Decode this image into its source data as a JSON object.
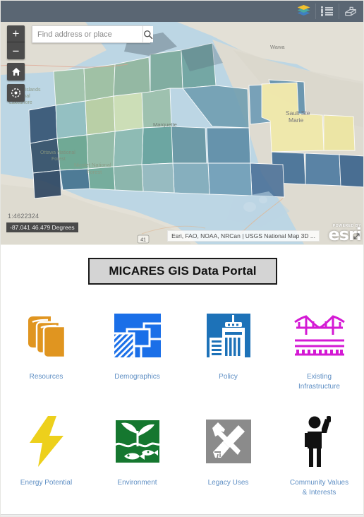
{
  "header": {
    "buttons": [
      {
        "name": "layers-icon",
        "label": "Layers"
      },
      {
        "name": "legend-icon",
        "label": "Legend"
      },
      {
        "name": "basemap-gallery-icon",
        "label": "Basemap Gallery"
      }
    ],
    "background_color": "#5a6673"
  },
  "map": {
    "search": {
      "placeholder": "Find address or place",
      "value": "",
      "button_icon": "search-icon"
    },
    "controls": {
      "zoom_in": "+",
      "zoom_out": "−",
      "home_icon": "home-icon",
      "locate_icon": "locate-icon"
    },
    "scale": "1:4622324",
    "coordinates": "-87.041 46.479 Degrees",
    "attribution": "Esri, FAO, NOAA, NRCan | USGS National Map 3D ...",
    "logo": {
      "powered_by": "POWERED BY",
      "brand": "esri"
    },
    "place_labels": [
      "Wawa",
      "Sault Ste Marie",
      "Marquette",
      "Apostle Islands National Lakeshore",
      "Ottawa National Forest",
      "Nicolet National Forest"
    ],
    "highway_shield": "41",
    "colors": {
      "water": "#bcd6e4",
      "land": "#e7e3da",
      "choropleth": [
        "#f4edb0",
        "#dce8bb",
        "#b7d3c5",
        "#8fbdbe",
        "#5d8fad",
        "#3d6b94",
        "#2f4f6f",
        "#263d58"
      ]
    }
  },
  "panel": {
    "title": "MICARES GIS Data Portal",
    "tiles": [
      {
        "label": "Resources",
        "icon": "books-icon",
        "color": "#e09520"
      },
      {
        "label": "Demographics",
        "icon": "parcel-map-icon",
        "color": "#1a6fe8"
      },
      {
        "label": "Policy",
        "icon": "city-building-icon",
        "color": "#1d72b8"
      },
      {
        "label": "Existing\nInfrastructure",
        "icon": "bridge-icon",
        "color": "#d41ad4"
      },
      {
        "label": "Energy Potential",
        "icon": "lightning-bolt-icon",
        "color": "#edd01c"
      },
      {
        "label": "Environment",
        "icon": "plant-fish-icon",
        "color": "#15772f"
      },
      {
        "label": "Legacy Uses",
        "icon": "hammer-shovel-icon",
        "color": "#8b8b8b"
      },
      {
        "label": "Community Values\n& Interests",
        "icon": "person-raised-arm-icon",
        "color": "#111111"
      }
    ],
    "label_color": "#5f8fc4"
  }
}
